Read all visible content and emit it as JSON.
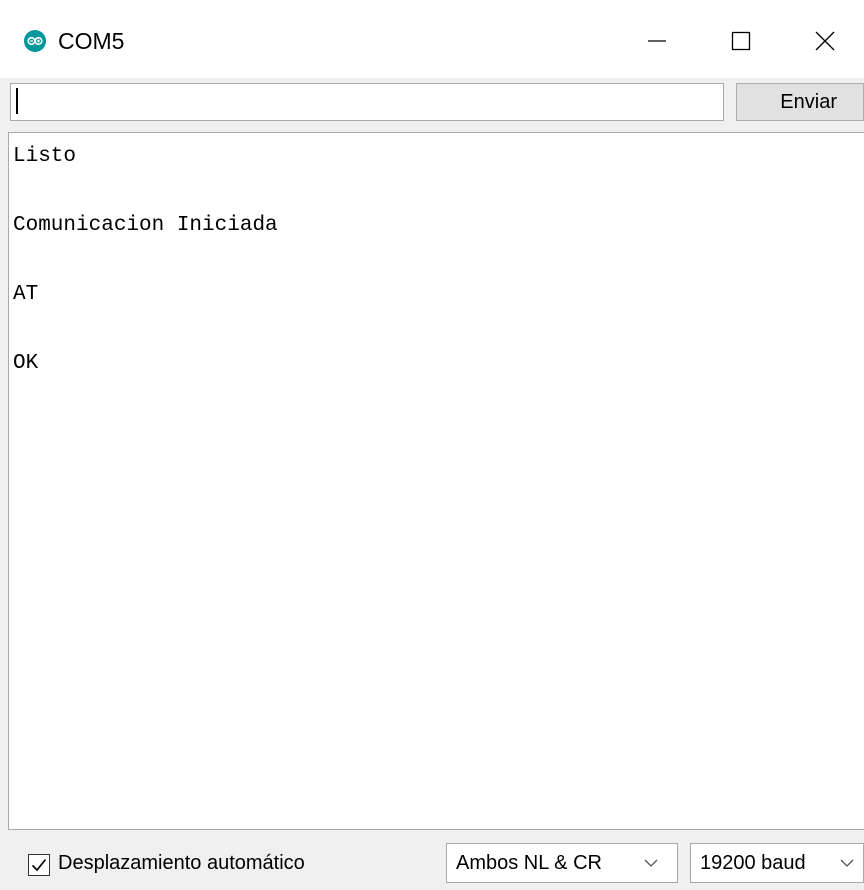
{
  "window": {
    "title": "COM5",
    "app_icon": "arduino-icon",
    "accent_color": "#00979c",
    "controls": [
      "minimize-icon",
      "maximize-icon",
      "close-icon"
    ]
  },
  "send_bar": {
    "input_value": "",
    "send_label": "Enviar"
  },
  "output": {
    "lines": [
      "Listo",
      "Comunicacion Iniciada",
      "AT",
      "OK"
    ]
  },
  "status_bar": {
    "autoscroll_label": "Desplazamiento automático",
    "autoscroll_checked": true,
    "line_ending": "Ambos NL & CR",
    "baud_rate": "19200 baud"
  }
}
